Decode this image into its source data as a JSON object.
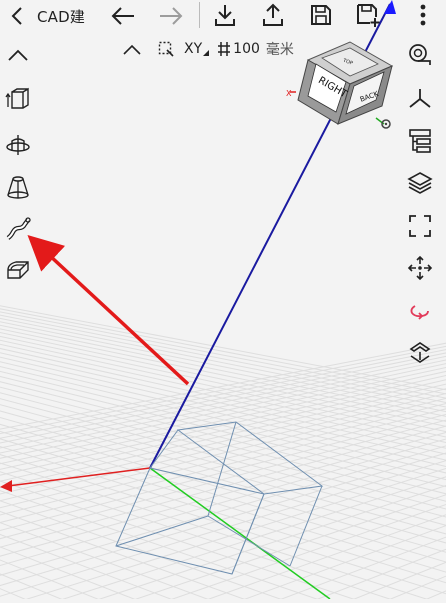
{
  "app": {
    "title": "CAD建"
  },
  "subbar": {
    "plane": "XY",
    "grid_value": "100",
    "unit": "毫米"
  },
  "viewcube": {
    "front_label": "RIGHT",
    "side_label": "BACK",
    "top_label": "TOP"
  },
  "icons": {
    "back": "chevron-left-icon",
    "undo": "arrow-left-icon",
    "redo": "arrow-right-icon",
    "import": "download-icon",
    "export": "upload-icon",
    "save": "floppy-disk-icon",
    "save_as": "floppy-disk-plus-icon",
    "menu": "more-vertical-icon",
    "collapse": "chevron-up-icon",
    "selection": "selection-box-icon",
    "grid": "grid-icon",
    "extrude": "extrude-cube-icon",
    "revolve": "revolve-icon",
    "loft": "loft-cone-icon",
    "sweep": "sweep-path-icon",
    "shell": "shell-icon",
    "snap": "snap-magnet-icon",
    "axes": "axes-icon",
    "layers_tree": "tree-icon",
    "layers": "layers-icon",
    "fit_view": "fit-frame-icon",
    "move_view": "move-arrows-icon",
    "rotate_view": "rotate-icon",
    "flip": "flip-icon"
  },
  "colors": {
    "x_axis": "#e02020",
    "y_axis": "#22cc22",
    "z_axis": "#1a1aa0",
    "annotation_arrow": "#e31a1a",
    "rotate_accent": "#e23b5a",
    "grid_line": "#dcdcdc",
    "wire": "#6f8fb0"
  }
}
